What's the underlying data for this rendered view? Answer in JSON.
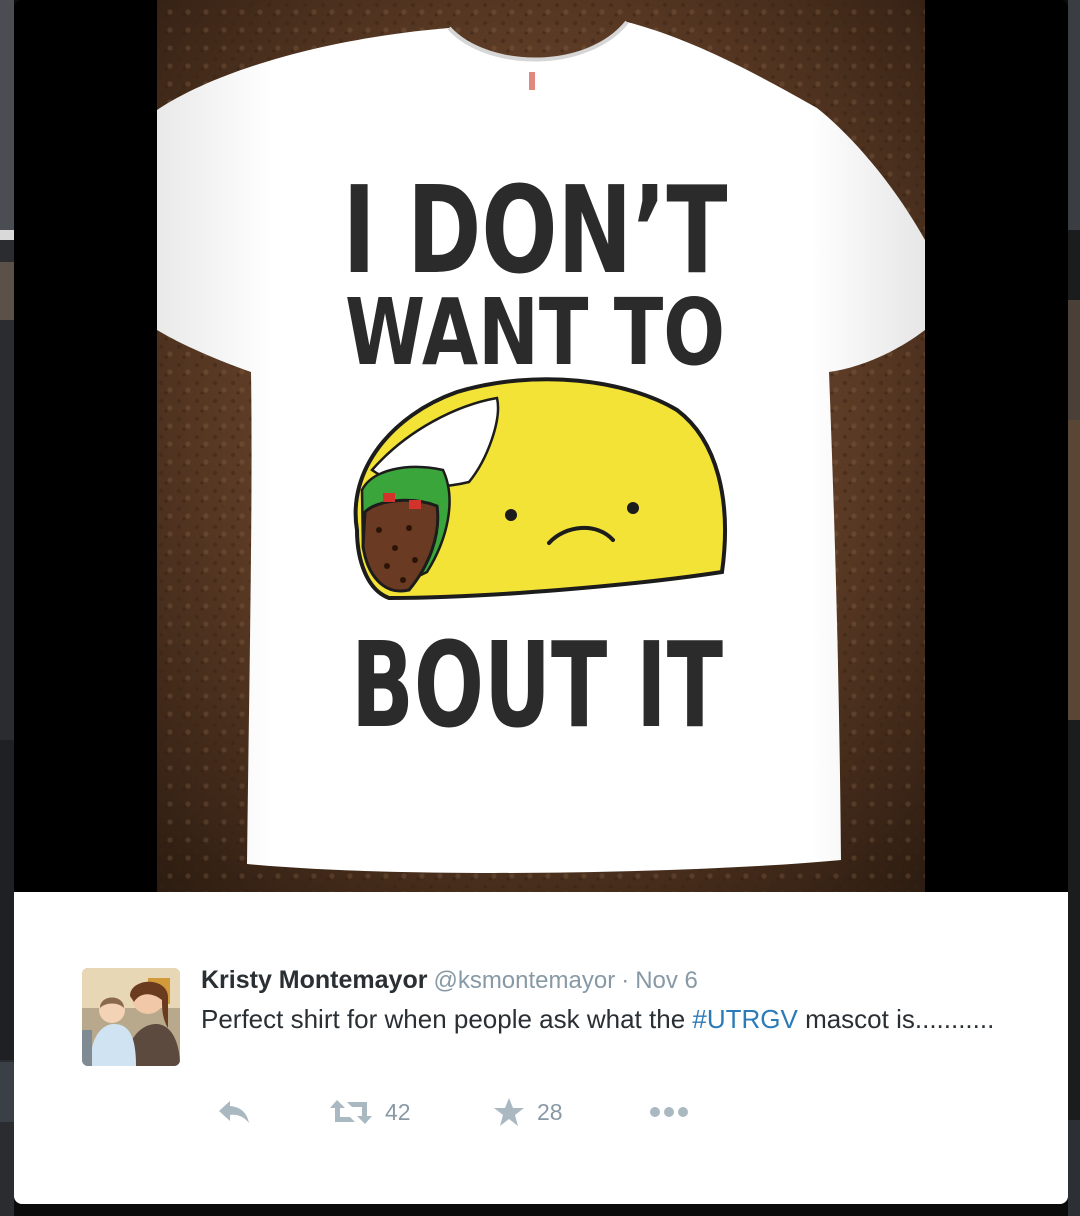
{
  "poster": {
    "shirt_line_1": "I DON’T",
    "shirt_line_2": "WANT TO",
    "shirt_line_3": "BOUT IT"
  },
  "tweet": {
    "display_name": "Kristy Montemayor",
    "username": "@ksmontemayor",
    "separator": "·",
    "timestamp": "Nov 6",
    "text_before": "Perfect shirt for when people ask what the ",
    "hashtag": "#UTRGV",
    "text_after": " mascot is...........",
    "retweet_count": "42",
    "favorite_count": "28"
  },
  "icons": [
    "reply-icon",
    "retweet-icon",
    "favorite-icon",
    "more-icon"
  ],
  "colors": {
    "hashtag": "#2b7bb9",
    "name": "#292f33",
    "meta": "#8899a6",
    "taco_shell": "#f3e337",
    "leather": "#5a3a24"
  }
}
